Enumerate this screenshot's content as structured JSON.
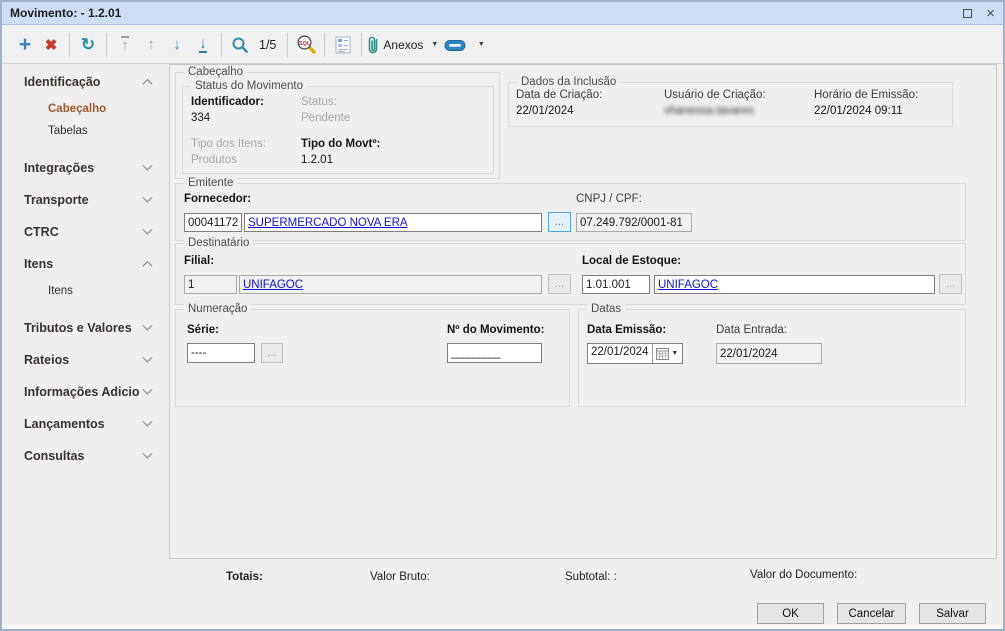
{
  "window": {
    "title": "Movimento: - 1.2.01"
  },
  "icons": {
    "add": "+",
    "delete": "✖",
    "refresh": "↻",
    "first": "↑",
    "previous": "↑",
    "next": "↓",
    "last": "↓",
    "dropdown": "▼",
    "close": "×",
    "lookup_dots": "..."
  },
  "toolbar": {
    "record_counter": "1/5",
    "anexos_label": "Anexos"
  },
  "sidebar": {
    "sections": [
      {
        "label": "Identificação",
        "expanded": true,
        "children": [
          {
            "label": "Cabeçalho",
            "selected": true
          },
          {
            "label": "Tabelas",
            "selected": false
          }
        ]
      },
      {
        "label": "Integrações",
        "expanded": false
      },
      {
        "label": "Transporte",
        "expanded": false
      },
      {
        "label": "CTRC",
        "expanded": false
      },
      {
        "label": "Itens",
        "expanded": true,
        "children": [
          {
            "label": "Itens",
            "selected": false
          }
        ]
      },
      {
        "label": "Tributos e Valores",
        "expanded": false
      },
      {
        "label": "Rateios",
        "expanded": false
      },
      {
        "label": "Informações Adicio",
        "expanded": false
      },
      {
        "label": "Lançamentos",
        "expanded": false
      },
      {
        "label": "Consultas",
        "expanded": false
      }
    ]
  },
  "header_group": {
    "title": "Cabeçalho",
    "status_group": {
      "title": "Status do Movimento",
      "identificador_label": "Identificador:",
      "identificador_value": "334",
      "status_label": "Status:",
      "status_value": "Pendente",
      "tipo_itens_label": "Tipo dos Itens:",
      "tipo_itens_value": "Produtos",
      "tipo_movto_label": "Tipo do Movtº:",
      "tipo_movto_value": "1.2.01"
    },
    "inclusao_group": {
      "title": "Dados da Inclusão",
      "data_criacao_label": "Data de Criação:",
      "data_criacao_value": "22/01/2024",
      "usuario_label": "Usuário de Criação:",
      "usuario_value": "vhanessa.tavares",
      "horario_label": "Horário de Emissão:",
      "horario_value": "22/01/2024 09:11"
    }
  },
  "emitente_group": {
    "title": "Emitente",
    "fornecedor_label": "Fornecedor:",
    "fornecedor_code": "00041172",
    "fornecedor_name": "SUPERMERCADO NOVA ERA",
    "cnpj_label": "CNPJ / CPF:",
    "cnpj_value": "07.249.792/0001-81"
  },
  "destinatario_group": {
    "title": "Destinatário",
    "filial_label": "Filial:",
    "filial_code": "1",
    "filial_name": "UNIFAGOC",
    "local_label": "Local de Estoque:",
    "local_code": "1.01.001",
    "local_name": "UNIFAGOC"
  },
  "numeracao_group": {
    "title": "Numeração",
    "serie_label": "Série:",
    "serie_value": "----",
    "num_movimento_label": "Nº do Movimento:",
    "num_movimento_mask": "_________"
  },
  "datas_group": {
    "title": "Datas",
    "data_emissao_label": "Data Emissão:",
    "data_emissao_value": "22/01/2024",
    "data_entrada_label": "Data Entrada:",
    "data_entrada_value": "22/01/2024"
  },
  "totals": {
    "totais_label": "Totais:",
    "valor_bruto_label": "Valor Bruto:",
    "subtotal_label": "Subtotal: :",
    "valor_documento_label": "Valor do Documento:"
  },
  "footer_buttons": {
    "ok": "OK",
    "cancel": "Cancelar",
    "save": "Salvar"
  },
  "colors": {
    "link": "#1212cc",
    "selected_nav": "#9b5a2f",
    "titlebar_bg": "#cfddf4",
    "accent_teal": "#2792a6"
  }
}
